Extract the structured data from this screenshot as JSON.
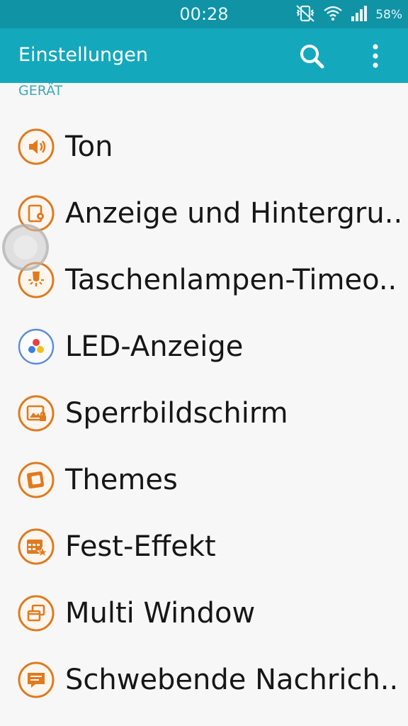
{
  "status_bar": {
    "time": "00:28",
    "battery": "58%",
    "icons": [
      "mute-vibrate-icon",
      "wifi-icon",
      "signal-icon"
    ]
  },
  "app_bar": {
    "title": "Einstellungen",
    "actions": [
      "search-icon",
      "more-options-icon"
    ]
  },
  "section": {
    "header": "GERÄT"
  },
  "items": [
    {
      "label": "Ton",
      "icon": "speaker-icon",
      "color": "#e07a1f"
    },
    {
      "label": "Anzeige und Hintergru..",
      "icon": "display-icon",
      "color": "#e07a1f"
    },
    {
      "label": "Taschenlampen-Timeo..",
      "icon": "flashlight-icon",
      "color": "#e07a1f"
    },
    {
      "label": "LED-Anzeige",
      "icon": "led-icon",
      "color": "#5b8bd9"
    },
    {
      "label": "Sperrbildschirm",
      "icon": "lock-screen-icon",
      "color": "#e07a1f"
    },
    {
      "label": "Themes",
      "icon": "themes-icon",
      "color": "#e07a1f"
    },
    {
      "label": "Fest-Effekt",
      "icon": "festive-effect-icon",
      "color": "#e07a1f"
    },
    {
      "label": "Multi Window",
      "icon": "multi-window-icon",
      "color": "#e07a1f"
    },
    {
      "label": "Schwebende Nachrich..",
      "icon": "floating-message-icon",
      "color": "#e07a1f"
    }
  ],
  "colors": {
    "status_bar": "#0f93a5",
    "app_bar": "#14a8bc",
    "accent": "#e07a1f"
  }
}
